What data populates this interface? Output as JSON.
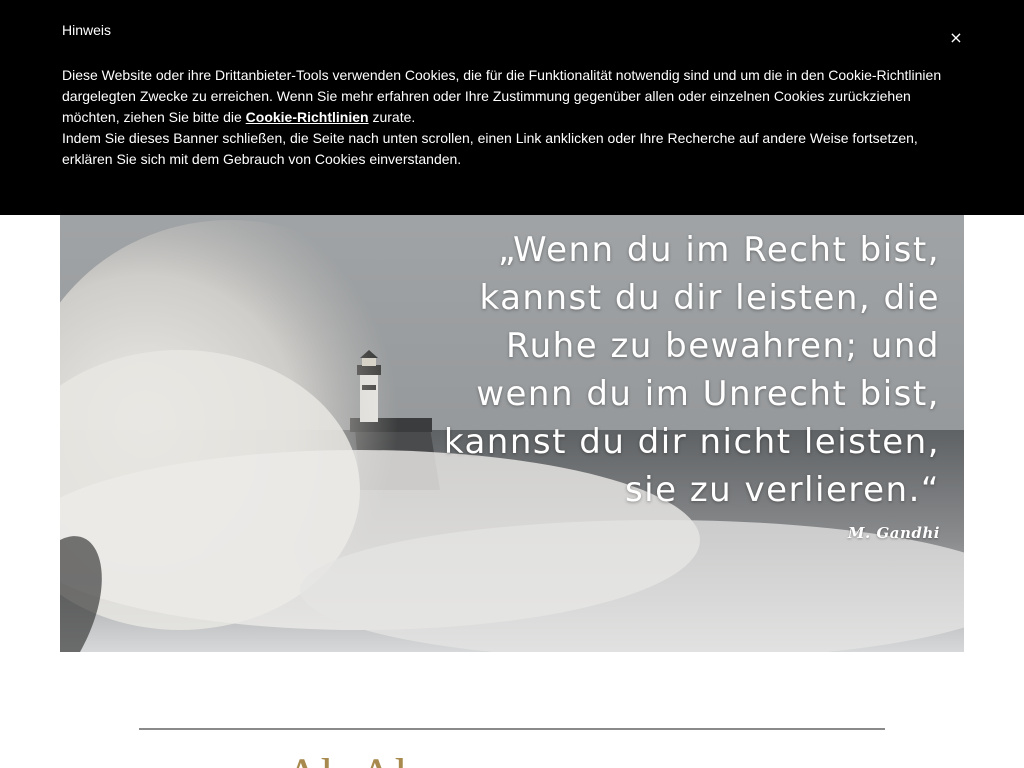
{
  "cookie_banner": {
    "title": "Hinweis",
    "close_label": "×",
    "paragraph1_before_link": "Diese Website oder ihre Drittanbieter-Tools verwenden Cookies, die für die Funktionalität notwendig sind und um die in den Cookie-Richtlinien dargelegten Zwecke zu erreichen. Wenn Sie mehr erfahren oder Ihre Zustimmung gegenüber allen oder einzelnen Cookies zurückziehen möchten, ziehen Sie bitte die ",
    "link_label": "Cookie-Richtlinien",
    "paragraph1_after_link": " zurate.",
    "paragraph2": "Indem Sie dieses Banner schließen, die Seite nach unten scrollen, einen Link anklicken oder Ihre Recherche auf andere Weise fortsetzen, erklären Sie sich mit dem Gebrauch von Cookies einverstanden."
  },
  "hero": {
    "quote_lines": [
      "„Wenn du im Recht bist,",
      "kannst du dir leisten, die",
      "Ruhe zu bewahren; und",
      "wenn du im Unrecht bist,",
      "kannst du dir nicht leisten,",
      "sie zu verlieren.“"
    ],
    "author": "M. Gandhi"
  },
  "section": {
    "heading_partial": "Ab       Ab"
  },
  "colors": {
    "banner_bg": "#000000",
    "banner_text": "#ffffff",
    "heading_gold": "#a88a4e",
    "divider": "#8a8a8a"
  }
}
